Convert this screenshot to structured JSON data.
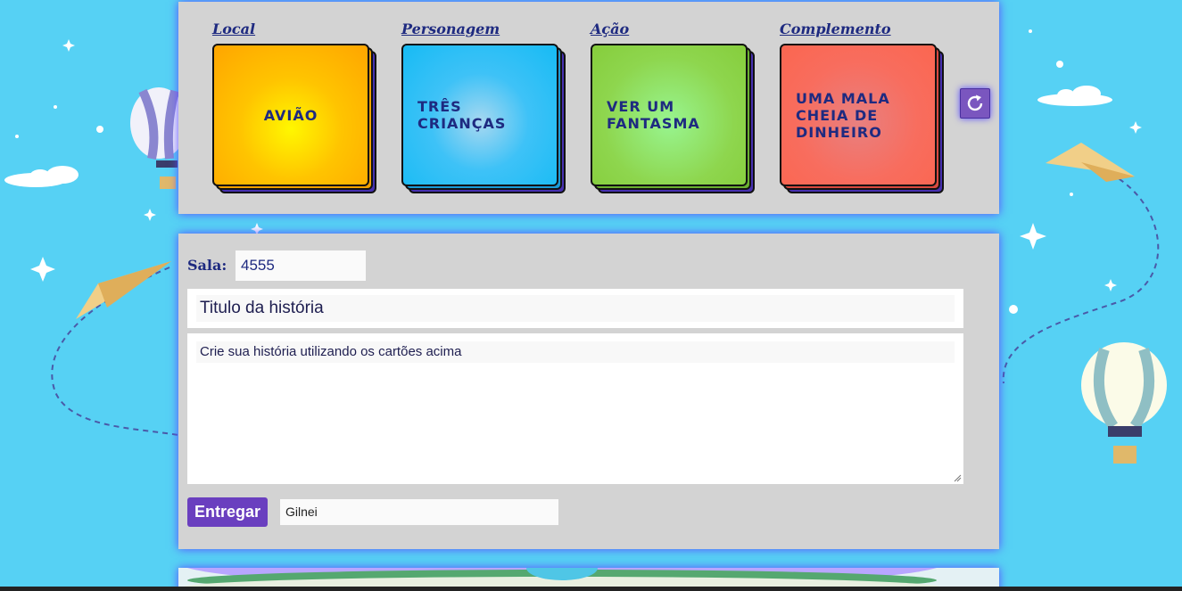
{
  "columns": [
    {
      "label": "Local",
      "card": "AVIÃO"
    },
    {
      "label": "Personagem",
      "card": "TRÊS CRIANÇAS"
    },
    {
      "label": "Ação",
      "card": "VER UM FANTASMA"
    },
    {
      "label": "Complemento",
      "card": "UMA MALA CHEIA DE DINHEIRO"
    }
  ],
  "refresh_icon": "refresh-icon",
  "form": {
    "room_label": "Sala:",
    "room_value": "4555",
    "title_placeholder": "Titulo da história",
    "story_placeholder": "Crie sua história utilizando os cartões acima",
    "submit_label": "Entregar",
    "author_value": "Gilnei"
  },
  "colors": {
    "background": "#56d1f4",
    "panel": "#d3d3d3",
    "accent": "#6a3fbf",
    "label": "#1e2a80"
  }
}
